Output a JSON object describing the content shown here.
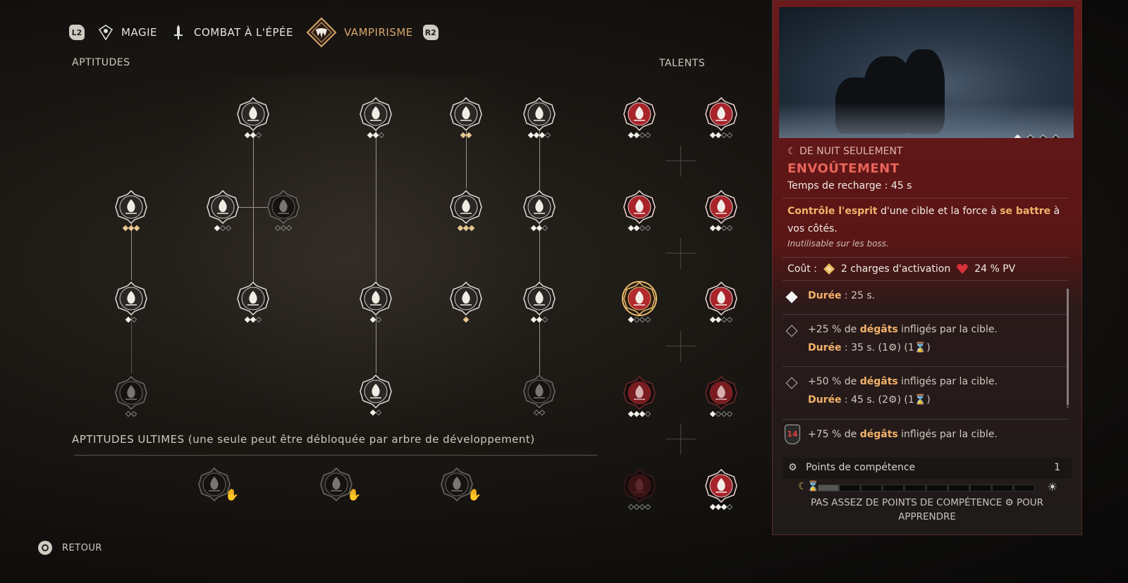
{
  "tabs": {
    "left_trigger": "L2",
    "right_trigger": "R2",
    "items": [
      {
        "label": "MAGIE",
        "icon": "magic-eye-icon",
        "active": false
      },
      {
        "label": "COMBAT À L'ÉPÉE",
        "icon": "sword-icon",
        "active": false
      },
      {
        "label": "VAMPIRISME",
        "icon": "vampire-fangs-icon",
        "active": true
      }
    ]
  },
  "sections": {
    "aptitudes": "APTITUDES",
    "talents": "TALENTS",
    "ultimate": "APTITUDES ULTIMES (une seule peut être débloquée par arbre de développement)"
  },
  "aptitude_nodes": [
    {
      "id": "mist-drop",
      "icon": "mist-drop-icon",
      "pips": [
        1,
        1,
        0
      ],
      "tone": "light"
    },
    {
      "id": "fangs-bite",
      "icon": "fangs-bite-icon",
      "pips": [
        1,
        1,
        0
      ],
      "tone": "light"
    },
    {
      "id": "eye-sigil",
      "icon": "eye-sigil-icon",
      "pips": [
        2,
        2
      ],
      "tone": "light"
    },
    {
      "id": "blood-rain",
      "icon": "blood-rain-icon",
      "pips": [
        1,
        1,
        1,
        0
      ],
      "tone": "light"
    },
    {
      "id": "flame-hand",
      "icon": "flame-hand-icon",
      "pips": [
        2,
        2,
        2
      ],
      "tone": "light"
    },
    {
      "id": "claw-fangs",
      "icon": "claw-fangs-icon",
      "pips": [
        1,
        0,
        0
      ],
      "tone": "light"
    },
    {
      "id": "dark-sigil",
      "icon": "dark-sigil-icon",
      "pips": [
        0,
        0,
        0
      ],
      "tone": "dark"
    },
    {
      "id": "bat-swarm",
      "icon": "bat-swarm-icon",
      "pips": [
        2,
        2,
        2
      ],
      "tone": "light"
    },
    {
      "id": "claw-slash",
      "icon": "claw-slash-icon",
      "pips": [
        1,
        1,
        0
      ],
      "tone": "light"
    },
    {
      "id": "blood-drops",
      "icon": "blood-drops-icon",
      "pips": [
        1,
        0
      ],
      "tone": "light"
    },
    {
      "id": "bone-hand",
      "icon": "bone-hand-icon",
      "pips": [
        1,
        1,
        0
      ],
      "tone": "light"
    },
    {
      "id": "crossed-blades",
      "icon": "crossed-blades-icon",
      "pips": [
        1,
        0
      ],
      "tone": "light"
    },
    {
      "id": "heart-rose",
      "icon": "heart-rose-icon",
      "pips": [
        2
      ],
      "tone": "light"
    },
    {
      "id": "triple-claw",
      "icon": "triple-claw-icon",
      "pips": [
        1,
        1,
        0
      ],
      "tone": "light"
    },
    {
      "id": "hidden-eye",
      "icon": "hidden-eye-icon",
      "pips": [
        0,
        0
      ],
      "tone": "dark"
    },
    {
      "id": "blood-chalice",
      "icon": "blood-chalice-icon",
      "pips": [
        1,
        0
      ],
      "tone": "light"
    },
    {
      "id": "beast-claw",
      "icon": "beast-claw-icon",
      "pips": [
        0,
        0
      ],
      "tone": "dark"
    }
  ],
  "talent_nodes": [
    {
      "id": "fang-flower",
      "icon": "fang-flower-icon",
      "pips": [
        1,
        1,
        0,
        0
      ],
      "tone": "red"
    },
    {
      "id": "bird-wing",
      "icon": "bird-wing-icon",
      "pips": [
        1,
        1,
        0,
        0
      ],
      "tone": "red"
    },
    {
      "id": "wolf-head",
      "icon": "wolf-head-icon",
      "pips": [
        1,
        1,
        0,
        0
      ],
      "tone": "red"
    },
    {
      "id": "spiked-burst",
      "icon": "spiked-burst-icon",
      "pips": [
        1,
        1,
        0,
        0
      ],
      "tone": "red"
    },
    {
      "id": "spiral-vortex",
      "icon": "spiral-vortex-icon",
      "pips": [
        1,
        0,
        0,
        0
      ],
      "tone": "selected"
    },
    {
      "id": "dragon-claw",
      "icon": "dragon-claw-icon",
      "pips": [
        1,
        1,
        0,
        0
      ],
      "tone": "red"
    },
    {
      "id": "bull-skull",
      "icon": "bull-skull-icon",
      "pips": [
        1,
        1,
        1,
        0
      ],
      "tone": "darkred"
    },
    {
      "id": "heart-thorn",
      "icon": "heart-thorn-icon",
      "pips": [
        1,
        0,
        0,
        0
      ],
      "tone": "darkred"
    },
    {
      "id": "slash-marks",
      "icon": "slash-marks-icon",
      "pips": [
        0,
        0,
        0,
        0
      ],
      "tone": "locked"
    },
    {
      "id": "wolf-howl",
      "icon": "wolf-howl-icon",
      "pips": [
        1,
        1,
        1,
        0
      ],
      "tone": "red"
    }
  ],
  "ultimate_nodes": [
    {
      "id": "ult-skull",
      "icon": "skull-icon"
    },
    {
      "id": "ult-eye",
      "icon": "demon-eye-icon"
    },
    {
      "id": "ult-rune",
      "icon": "rune-circle-icon"
    }
  ],
  "detail": {
    "video_pages": [
      1,
      0,
      0,
      0
    ],
    "restriction": "DE NUIT SEULEMENT",
    "title": "ENVOÛTEMENT",
    "cooldown": "Temps de recharge : 45 s",
    "desc_1": "Contrôle l'esprit",
    "desc_2": " d'une cible et la force à ",
    "desc_3": "se battre",
    "desc_4": " à vos côtés.",
    "note": "Inutilisable sur les boss.",
    "cost_label": "Coût :",
    "cost_charges": "2 charges d'activation",
    "cost_hp": "24 % PV",
    "levels": [
      {
        "line1_b": "Durée",
        "line1": " : 25 s.",
        "on": true
      },
      {
        "line1": "+25 % de ",
        "line1_b": "dégâts",
        "line1_end": " infligés par la cible.",
        "line2_b": "Durée",
        "line2": " : 35 s. (1⚙) (1⌛)",
        "on": false
      },
      {
        "line1": "+50 % de ",
        "line1_b": "dégâts",
        "line1_end": " infligés par la cible.",
        "line2_b": "Durée",
        "line2": " : 45 s. (2⚙) (1⌛)",
        "on": false
      },
      {
        "line1": "+75 % de ",
        "line1_b": "dégâts",
        "line1_end": " infligés par la cible.",
        "badge": "14",
        "on": false
      }
    ],
    "skill_points_label": "Points de compétence",
    "skill_points_value": "1",
    "warning": "PAS ASSEZ DE POINTS DE COMPÉTENCE ⚙ POUR APPRENDRE"
  },
  "footer": {
    "back": "RETOUR"
  },
  "colors": {
    "accent": "#d9a56a",
    "title_red": "#e8645a",
    "highlight": "#f3b36b",
    "panel_red": "#6a1a1a"
  }
}
